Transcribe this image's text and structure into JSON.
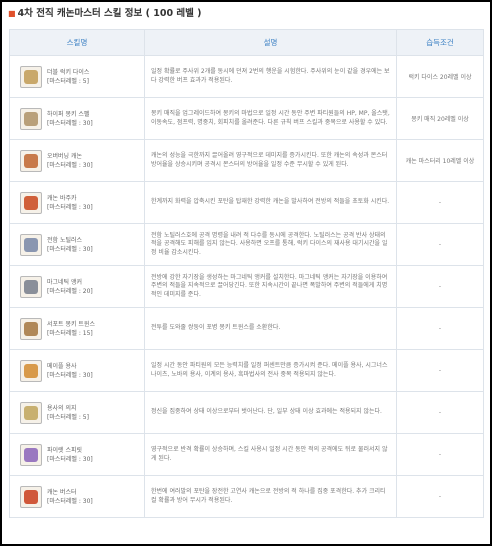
{
  "title": "4차 전직 캐논마스터 스킬 정보 ( 100 레벨 )",
  "columns": [
    "스킬명",
    "설명",
    "습득조건"
  ],
  "skills": [
    {
      "name": "더블 럭키 다이스",
      "master": "[마스터레벨 : 5]",
      "desc": "일정 확률로 주사위 2개를 동시에 던져 2번의 행운을 시험한다. 주사위의 눈이 같을 경우에는 보다 강력한 버프 효과가 적용된다.",
      "cond": "럭키 다이스 20레벨 이상",
      "icon": "dice-icon",
      "color": "#c9a86a"
    },
    {
      "name": "하이퍼 몽키 스펠",
      "master": "[마스터레벨 : 30]",
      "desc": "몽키 매직을 업그레이드하여 몽키의 마법으로 일정 시간 동안 주변 파티원들의 HP, MP, 올스탯, 이동속도, 점프력, 명중치, 회피치를 올려준다. 다른 규칙 버프 스킬과 중복으로 사용할 수 있다.",
      "cond": "몽키 매직 20레벨 이상",
      "icon": "monkey-icon",
      "color": "#b9a07a"
    },
    {
      "name": "오버버닝 캐논",
      "master": "[마스터레벨 : 30]",
      "desc": "캐논의 성능을 극한까지 끌어올려 영구적으로 데미지를 증가시킨다. 또한 캐논의 속성과 몬스터 방어율을 상승시키며 공격시 몬스터의 방어율을 일정 수준 무시할 수 있게 된다.",
      "cond": "캐논 마스터리 10레벨 이상",
      "icon": "cannon-icon",
      "color": "#c87a4a"
    },
    {
      "name": "캐논 바주카",
      "master": "[마스터레벨 : 30]",
      "desc": "한계까지 화력을 압축시킨 포탄을 탑재한 강력한 캐논을 발사하여 전방의 적들을 초토화 시킨다.",
      "cond": "-",
      "icon": "bazooka-icon",
      "color": "#d0603a"
    },
    {
      "name": "전함 노틸러스",
      "master": "[마스터레벨 : 30]",
      "desc": "전함 노틸러스호에 공격 명령을 내려 적 다수를 동시에 공격한다. 노틸러스는 공격 반사 상태의 적을 공격해도 피해를 입지 않는다. 사용하면 오프를 통해, 럭키 다이스의 재사용 대기시간을 일정 비율 감소시킨다.",
      "cond": "-",
      "icon": "ship-icon",
      "color": "#8a96b0"
    },
    {
      "name": "마그네틱 앵커",
      "master": "[마스터레벨 : 20]",
      "desc": "전방에 강한 자기장을 생성하는 마그네틱 앵커를 설치한다. 마그네틱 앵커는 자기장을 이용하여 주변의 적들을 지속적으로 끌어당긴다. 또한 지속시간이 끝나면 폭발하여 주변의 적들에게 치명적인 데미지를 준다.",
      "cond": "-",
      "icon": "anchor-icon",
      "color": "#8a8f99"
    },
    {
      "name": "서포트 몽키 트윈스",
      "master": "[마스터레벨 : 15]",
      "desc": "전투를 도와줄 쌍둥이 포병 몽키 트윈스를 소환한다.",
      "cond": "-",
      "icon": "twins-icon",
      "color": "#b08858"
    },
    {
      "name": "메이플 용사",
      "master": "[마스터레벨 : 30]",
      "desc": "일정 시간 동안 파티원의 모든 능력치를 일정 퍼센트만큼 증가시켜 준다. 메이플 용사, 시그너스 나이츠, 노바의 용사, 이계의 용사, 흑마법사의 전사 중복 적용되지 않는다.",
      "cond": "-",
      "icon": "hero-icon",
      "color": "#d89a4a"
    },
    {
      "name": "용사의 의지",
      "master": "[마스터레벨 : 5]",
      "desc": "정신을 집중하여 상태 이상으로부터 벗어난다. 단, 일부 상태 이상 효과에는 적용되지 않는다.",
      "cond": "-",
      "icon": "will-icon",
      "color": "#c8b070"
    },
    {
      "name": "파이렛 스피릿",
      "master": "[마스터레벨 : 30]",
      "desc": "영구적으로 반격 확률이 상승하며, 스킬 사용시 일정 시간 동안 적의 공격에도 뒤로 물러서지 않게 된다.",
      "cond": "-",
      "icon": "spirit-icon",
      "color": "#9a78c0"
    },
    {
      "name": "캐논 버스터",
      "master": "[마스터레벨 : 30]",
      "desc": "한번에 여러발의 포탄을 장전한 고연사 캐논으로 전방의 적 하나를 집중 포격한다. 추가 크리티컬 확률과 방어 무시가 적용된다.",
      "cond": "-",
      "icon": "buster-icon",
      "color": "#d0583a"
    }
  ]
}
